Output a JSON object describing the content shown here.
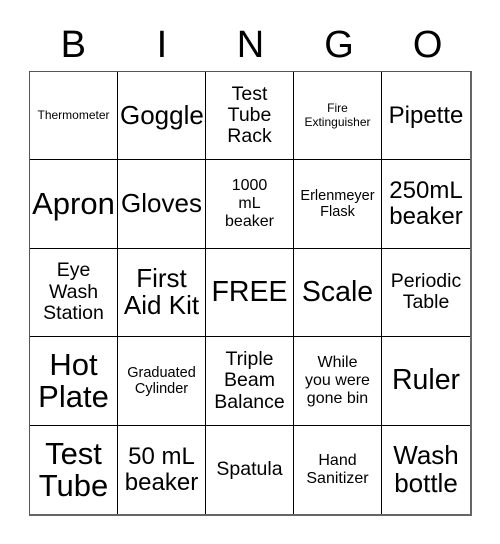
{
  "card": {
    "type": "bingo-card",
    "topic": "Science Lab Equipment Bingo",
    "columns": 5,
    "rows": 5,
    "background_color": "#ffffff",
    "text_color": "#000000",
    "border_color": "#000000"
  },
  "header": {
    "letters": [
      "B",
      "I",
      "N",
      "G",
      "O"
    ]
  },
  "grid": {
    "free_space_label": "FREE",
    "free_space_position": {
      "row": 3,
      "column": 3
    },
    "cells": [
      {
        "text": "Thermometer",
        "size": "fs-xs",
        "lines": 1,
        "row": 1,
        "column": 1
      },
      {
        "text": "Goggles",
        "size": "fs-xl",
        "lines": 1,
        "row": 1,
        "column": 2
      },
      {
        "text": "Test\nTube\nRack",
        "size": "fs-m",
        "lines": 3,
        "row": 1,
        "column": 3
      },
      {
        "text": "Fire\nExtinguisher",
        "size": "fs-xs",
        "lines": 2,
        "row": 1,
        "column": 4
      },
      {
        "text": "Pipette",
        "size": "fs-l",
        "lines": 1,
        "row": 1,
        "column": 5
      },
      {
        "text": "Apron",
        "size": "fs-3xl",
        "lines": 1,
        "row": 2,
        "column": 1
      },
      {
        "text": "Gloves",
        "size": "fs-xl",
        "lines": 1,
        "row": 2,
        "column": 2
      },
      {
        "text": "1000\nmL\nbeaker",
        "size": "fs-sm",
        "lines": 3,
        "row": 2,
        "column": 3
      },
      {
        "text": "Erlenmeyer\nFlask",
        "size": "fs-s",
        "lines": 2,
        "row": 2,
        "column": 4
      },
      {
        "text": "250mL\nbeaker",
        "size": "fs-l",
        "lines": 2,
        "row": 2,
        "column": 5
      },
      {
        "text": "Eye\nWash\nStation",
        "size": "fs-m",
        "lines": 3,
        "row": 3,
        "column": 1
      },
      {
        "text": "First\nAid Kit",
        "size": "fs-xl",
        "lines": 2,
        "row": 3,
        "column": 2
      },
      {
        "text": "FREE",
        "size": "fs-2xl",
        "lines": 1,
        "row": 3,
        "column": 3
      },
      {
        "text": "Scale",
        "size": "fs-2xl",
        "lines": 1,
        "row": 3,
        "column": 4
      },
      {
        "text": "Periodic\nTable",
        "size": "fs-m",
        "lines": 2,
        "row": 3,
        "column": 5
      },
      {
        "text": "Hot\nPlate",
        "size": "fs-3xl",
        "lines": 2,
        "row": 4,
        "column": 1
      },
      {
        "text": "Graduated\nCylinder",
        "size": "fs-s",
        "lines": 2,
        "row": 4,
        "column": 2
      },
      {
        "text": "Triple\nBeam\nBalance",
        "size": "fs-m",
        "lines": 3,
        "row": 4,
        "column": 3
      },
      {
        "text": "While\nyou were\ngone bin",
        "size": "fs-sm",
        "lines": 3,
        "row": 4,
        "column": 4
      },
      {
        "text": "Ruler",
        "size": "fs-2xl",
        "lines": 1,
        "row": 4,
        "column": 5
      },
      {
        "text": "Test\nTube",
        "size": "fs-3xl",
        "lines": 2,
        "row": 5,
        "column": 1
      },
      {
        "text": "50 mL\nbeaker",
        "size": "fs-l",
        "lines": 2,
        "row": 5,
        "column": 2
      },
      {
        "text": "Spatula",
        "size": "fs-m",
        "lines": 1,
        "row": 5,
        "column": 3
      },
      {
        "text": "Hand\nSanitizer",
        "size": "fs-sm",
        "lines": 2,
        "row": 5,
        "column": 4
      },
      {
        "text": "Wash\nbottle",
        "size": "fs-xl",
        "lines": 2,
        "row": 5,
        "column": 5
      }
    ]
  }
}
